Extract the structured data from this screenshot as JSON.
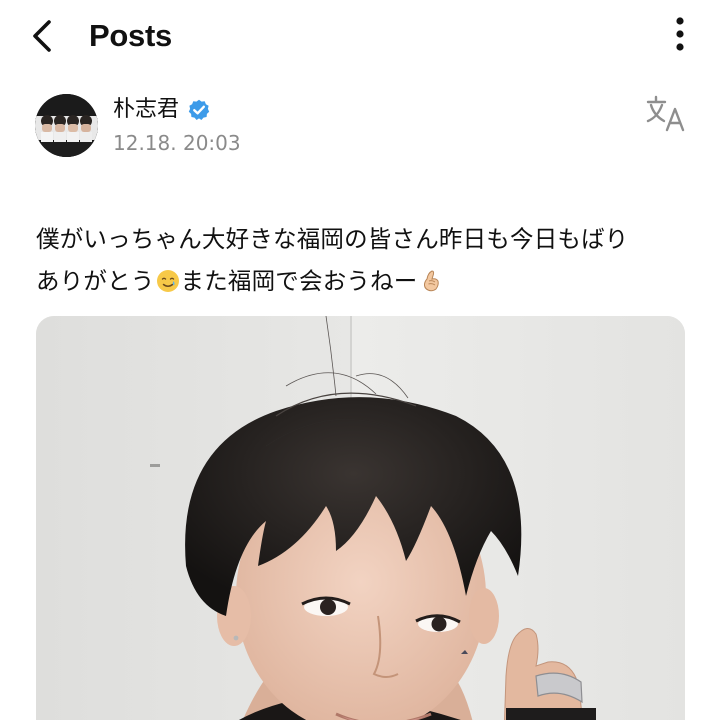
{
  "header": {
    "title": "Posts",
    "back_icon": "chevron-left-icon",
    "more_icon": "vertical-dots-icon"
  },
  "author": {
    "name": "朴志君",
    "verified_icon": "verified-badge-icon",
    "verified_color": "#3d9be9",
    "time": "12.18. 20:03",
    "translate_icon": "translate-icon"
  },
  "post": {
    "line1": "僕がいっちゃん大好きな福岡の皆さん昨日も今日もばり",
    "line2_before_emoji": "ありがとう",
    "emoji1": "smiling-face-with-tear-emoji",
    "line2_middle": "また福岡で会おうねー",
    "emoji2": "hand-with-index-finger-and-thumb-crossed-emoji"
  },
  "photo": {
    "type": "selfie photo"
  }
}
